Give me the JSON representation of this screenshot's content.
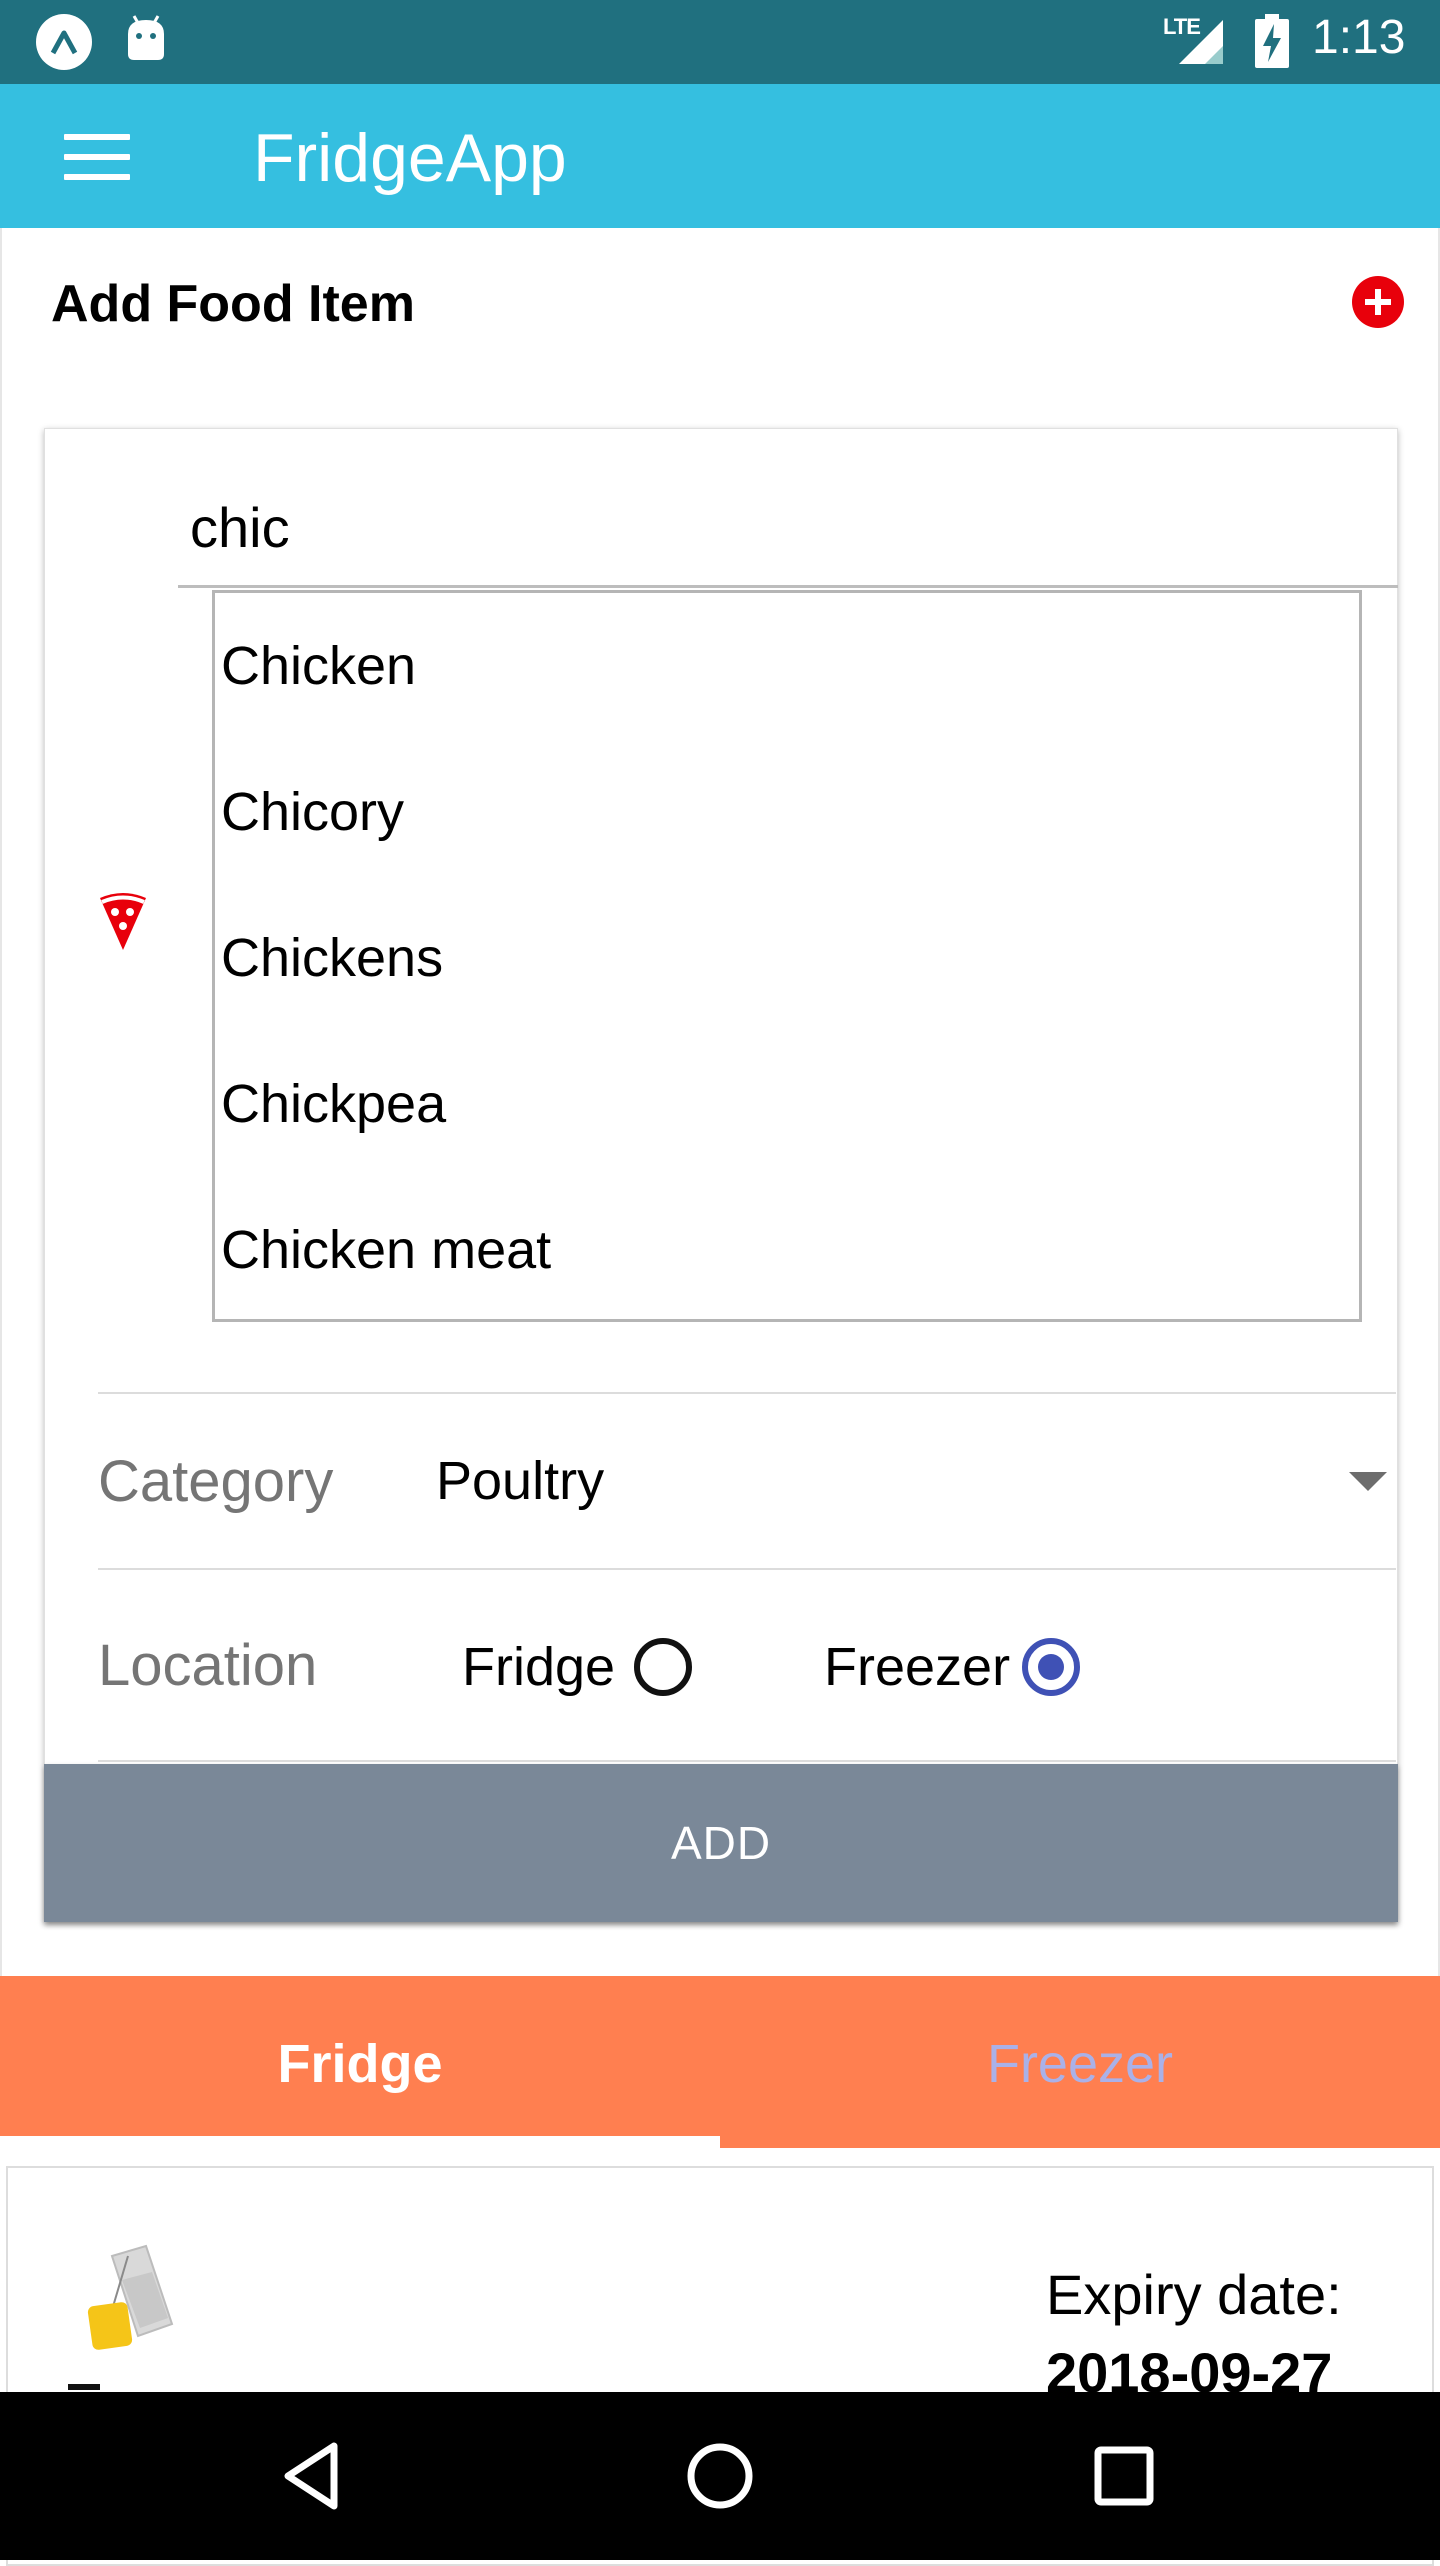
{
  "status_bar": {
    "time": "1:13",
    "network": "LTE",
    "icons": [
      "app-a-icon",
      "android-icon",
      "signal-icon",
      "battery-charging-icon"
    ]
  },
  "app_bar": {
    "title": "FridgeApp",
    "menu_icon": "hamburger-menu-icon",
    "background": "#35bfe0"
  },
  "add_section": {
    "title": "Add Food Item",
    "add_icon": "add-circle-icon",
    "food_input": {
      "value": "chic",
      "icon": "pizza-icon"
    },
    "suggestions": [
      "Chicken",
      "Chicory",
      "Chickens",
      "Chickpea",
      "Chicken meat"
    ],
    "category": {
      "label": "Category",
      "value": "Poultry"
    },
    "location": {
      "label": "Location",
      "options": [
        {
          "label": "Fridge",
          "selected": false
        },
        {
          "label": "Freezer",
          "selected": true
        }
      ]
    },
    "add_button_label": "ADD"
  },
  "tabs": [
    {
      "label": "Fridge",
      "active": true
    },
    {
      "label": "Freezer",
      "active": false
    }
  ],
  "list": {
    "items": [
      {
        "icon": "tea-bag-icon",
        "expiry_label": "Expiry date:",
        "expiry_date": "2018-09-27"
      }
    ]
  },
  "nav_bar": {
    "buttons": [
      "back-icon",
      "home-icon",
      "recents-icon"
    ]
  },
  "colors": {
    "status_bar": "#20707f",
    "app_bar": "#35bfe0",
    "tab_bar": "#ff7f50",
    "add_button": "#7a8898",
    "radio_selected": "#3f51b5",
    "add_icon": "#e8000b"
  }
}
